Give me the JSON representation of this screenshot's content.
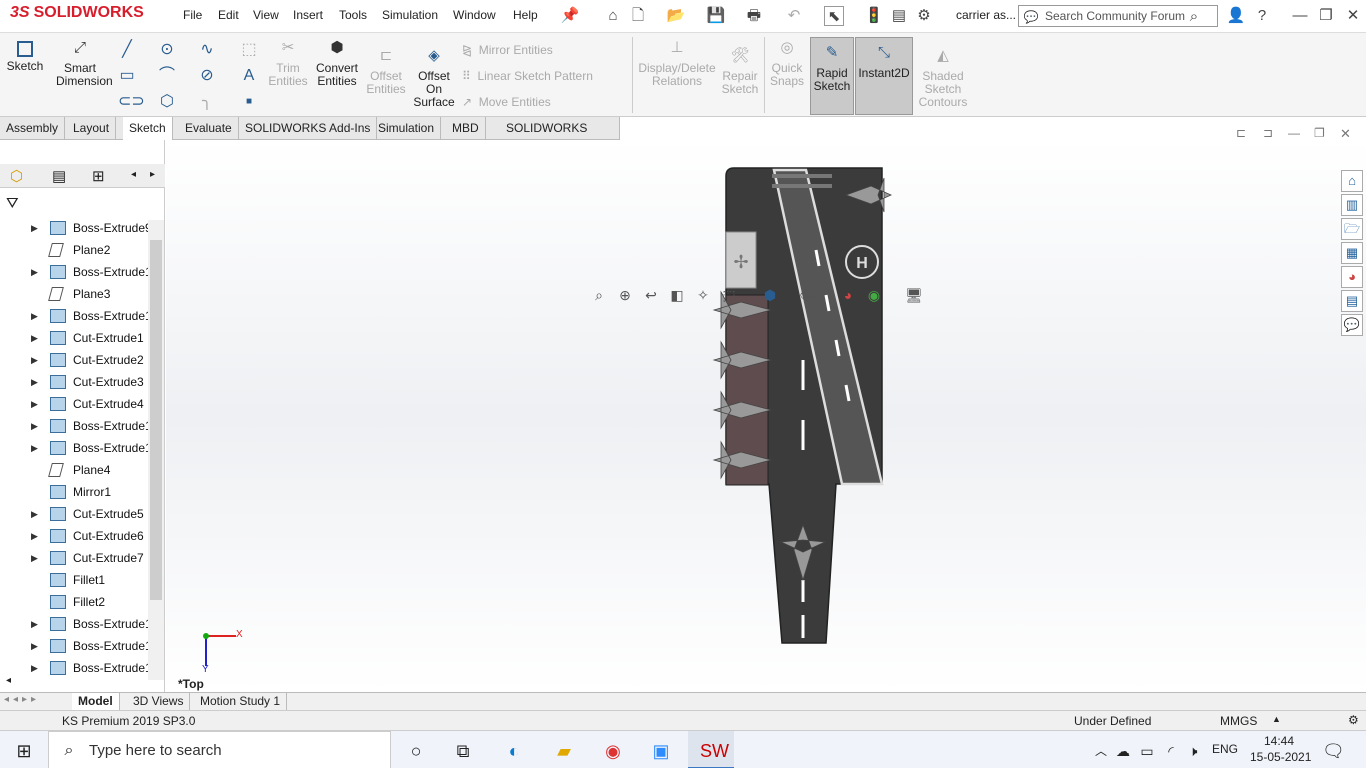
{
  "app": {
    "logo_prefix": "3S",
    "logo_text": "SOLIDWORKS",
    "doc_title": "carrier as..."
  },
  "menu": [
    "File",
    "Edit",
    "View",
    "Insert",
    "Tools",
    "Simulation",
    "Window",
    "Help"
  ],
  "search": {
    "placeholder": "Search Community Forum"
  },
  "ribbon": {
    "sketch": "Sketch",
    "smart_dim_1": "Smart",
    "smart_dim_2": "Dimension",
    "trim_1": "Trim",
    "trim_2": "Entities",
    "convert_1": "Convert",
    "convert_2": "Entities",
    "offset_1": "Offset",
    "offset_2": "Entities",
    "offset_surface_1": "Offset",
    "offset_surface_2": "On",
    "offset_surface_3": "Surface",
    "mirror": "Mirror Entities",
    "linear_pattern": "Linear Sketch Pattern",
    "move": "Move Entities",
    "display_delete_1": "Display/Delete",
    "display_delete_2": "Relations",
    "repair_1": "Repair",
    "repair_2": "Sketch",
    "quick_snaps_1": "Quick",
    "quick_snaps_2": "Snaps",
    "rapid_1": "Rapid",
    "rapid_2": "Sketch",
    "instant2d": "Instant2D",
    "shaded_1": "Shaded",
    "shaded_2": "Sketch",
    "shaded_3": "Contours"
  },
  "tabs": [
    "Assembly",
    "Layout",
    "Sketch",
    "Evaluate",
    "SOLIDWORKS Add-Ins",
    "Simulation",
    "MBD",
    "SOLIDWORKS CAM"
  ],
  "active_tab": "Sketch",
  "tree": [
    {
      "label": "Boss-Extrude9",
      "type": "feature",
      "expand": true
    },
    {
      "label": "Plane2",
      "type": "plane",
      "expand": false
    },
    {
      "label": "Boss-Extrude1",
      "type": "feature",
      "expand": true
    },
    {
      "label": "Plane3",
      "type": "plane",
      "expand": false
    },
    {
      "label": "Boss-Extrude1",
      "type": "feature",
      "expand": true
    },
    {
      "label": "Cut-Extrude1",
      "type": "feature",
      "expand": true
    },
    {
      "label": "Cut-Extrude2",
      "type": "feature",
      "expand": true
    },
    {
      "label": "Cut-Extrude3",
      "type": "feature",
      "expand": true
    },
    {
      "label": "Cut-Extrude4",
      "type": "feature",
      "expand": true
    },
    {
      "label": "Boss-Extrude1",
      "type": "feature",
      "expand": true
    },
    {
      "label": "Boss-Extrude1",
      "type": "feature",
      "expand": true
    },
    {
      "label": "Plane4",
      "type": "plane",
      "expand": false
    },
    {
      "label": "Mirror1",
      "type": "feature",
      "expand": false
    },
    {
      "label": "Cut-Extrude5",
      "type": "feature",
      "expand": true
    },
    {
      "label": "Cut-Extrude6",
      "type": "feature",
      "expand": true
    },
    {
      "label": "Cut-Extrude7",
      "type": "feature",
      "expand": true
    },
    {
      "label": "Fillet1",
      "type": "feature",
      "expand": false
    },
    {
      "label": "Fillet2",
      "type": "feature",
      "expand": false
    },
    {
      "label": "Boss-Extrude1",
      "type": "feature",
      "expand": true
    },
    {
      "label": "Boss-Extrude1",
      "type": "feature",
      "expand": true
    },
    {
      "label": "Boss-Extrude1",
      "type": "feature",
      "expand": true
    }
  ],
  "viewport": {
    "view_label": "*Top",
    "axis_x": "X",
    "axis_y": "Y"
  },
  "bottom_tabs": [
    "Model",
    "3D Views",
    "Motion Study 1"
  ],
  "status": {
    "left": "KS Premium 2019 SP3.0",
    "state": "Under Defined",
    "units": "MMGS"
  },
  "taskbar": {
    "search": "Type here to search",
    "lang": "ENG",
    "time": "14:44",
    "date": "15-05-2021"
  }
}
